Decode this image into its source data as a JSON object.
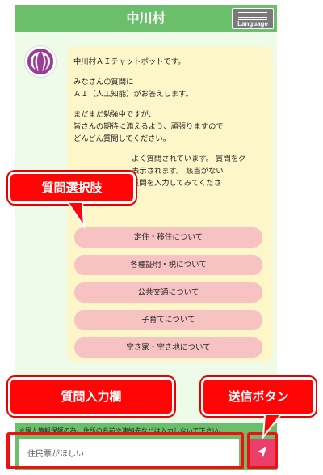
{
  "header": {
    "title": "中川村",
    "language_label": "Language"
  },
  "chat": {
    "paragraphs": [
      "中川村ＡＩチャットボットです。",
      "みなさんの質問に\nＡＩ（人工知能）がお答えします。",
      "まだまだ勉強中ですが、\n皆さんの期待に添えるよう、頑張りますので\nどんどん質問してください。",
      "よく質問されています。 質問をク\n表示されます。 該当がない\n質問を入力してみてくださ"
    ],
    "choices": [
      "定住・移住について",
      "各種証明・税について",
      "公共交通について",
      "子育てについて",
      "空き家・空き地について"
    ]
  },
  "footer": {
    "notice": "※個人情報保護の為、住所の名前や連絡先などは入力しないで下さい。",
    "input_value": "住民票がほしい"
  },
  "callouts": {
    "choices": "質問選択肢",
    "input": "質問入力欄",
    "send": "送信ボタン"
  },
  "colors": {
    "header_green": "#6cbf6a",
    "bubble": "#fdf6c8",
    "choice_pink": "#f7c2c2",
    "send_button": "#e93f6a",
    "callout_red": "#ff0505",
    "logo_purple": "#9b3d96"
  },
  "icons": {
    "logo": "village-emblem-icon",
    "language": "language-icon",
    "send": "send-arrow-icon"
  }
}
